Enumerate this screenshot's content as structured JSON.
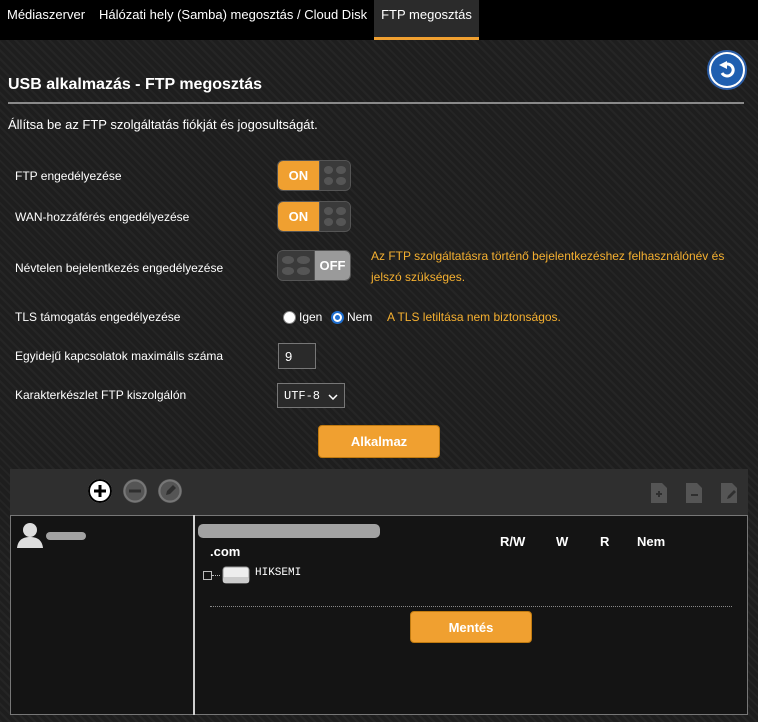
{
  "tabs": [
    {
      "label": "Médiaszerver",
      "active": false
    },
    {
      "label": "Hálózati hely (Samba) megosztás / Cloud Disk",
      "active": false
    },
    {
      "label": "FTP megosztás",
      "active": true
    }
  ],
  "page": {
    "title": "USB alkalmazás - FTP megosztás",
    "description": "Állítsa be az FTP szolgáltatás fiókját és jogosultságát."
  },
  "settings": {
    "ftp_enable": {
      "label": "FTP engedélyezése",
      "state": "ON"
    },
    "wan_access": {
      "label": "WAN-hozzáférés engedélyezése",
      "state": "ON"
    },
    "anonymous_login": {
      "label": "Névtelen bejelentkezés engedélyezése",
      "state": "OFF",
      "hint_line1": "Az FTP szolgáltatásra történő bejelentkezéshez felhasználónév és",
      "hint_line2": "jelszó szükséges."
    },
    "tls": {
      "label": "TLS támogatás engedélyezése",
      "option_yes": "Igen",
      "option_no": "Nem",
      "selected": "Nem",
      "hint": "A TLS letiltása nem biztonságos."
    },
    "max_connections": {
      "label": "Egyidejű kapcsolatok maximális száma",
      "value": "9"
    },
    "charset": {
      "label": "Karakterkészlet FTP kiszolgálón",
      "value": "UTF-8"
    }
  },
  "apply_label": "Alkalmaz",
  "permissions": {
    "domain_suffix": ".com",
    "columns": [
      "R/W",
      "W",
      "R",
      "Nem"
    ],
    "folder": "HIKSEMI",
    "save_label": "Mentés"
  },
  "colors": {
    "accent": "#f0a030",
    "hint": "#f5b030",
    "radio": "#1f6fd0"
  }
}
